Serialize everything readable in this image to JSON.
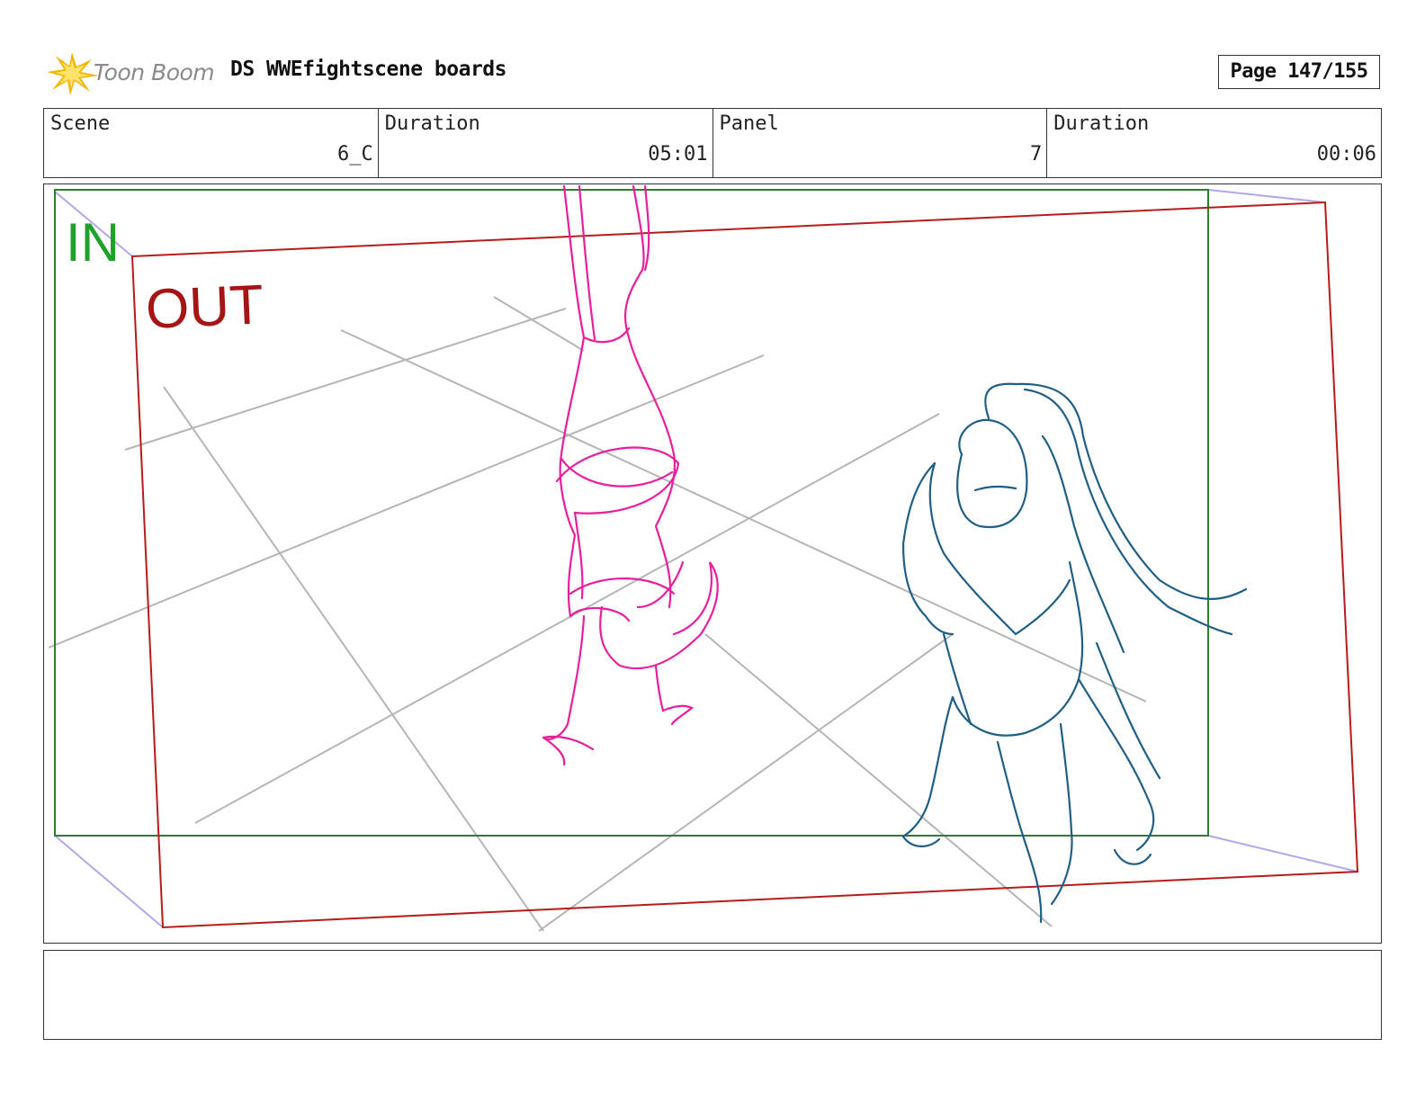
{
  "header": {
    "logo_text": "Toon Boom",
    "doc_title": "DS WWEfightscene boards",
    "page_label": "Page 147/155"
  },
  "info": {
    "scene_label": "Scene",
    "scene_value": "6_C",
    "scene_duration_label": "Duration",
    "scene_duration_value": "05:01",
    "panel_label": "Panel",
    "panel_value": "7",
    "panel_duration_label": "Duration",
    "panel_duration_value": "00:06"
  },
  "panel": {
    "in_label": "IN",
    "out_label": "OUT",
    "colors": {
      "in_frame": "#2e7d32",
      "out_frame": "#b71c1c",
      "grid": "#b5b5b5",
      "figure_pink": "#e91e9c",
      "figure_blue": "#1f5f86",
      "motion_arrows": "#b0a8e8"
    }
  },
  "notes": {
    "text": ""
  }
}
